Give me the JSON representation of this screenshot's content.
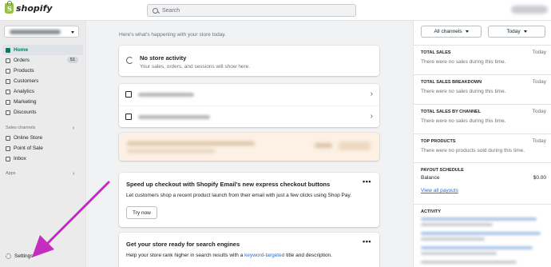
{
  "topbar": {
    "logo_text": "shopify",
    "search_placeholder": "Search"
  },
  "sidebar": {
    "items": [
      {
        "label": "Home",
        "icon": "home-icon",
        "active": true
      },
      {
        "label": "Orders",
        "icon": "orders-icon",
        "badge": "51"
      },
      {
        "label": "Products",
        "icon": "tag-icon"
      },
      {
        "label": "Customers",
        "icon": "person-icon"
      },
      {
        "label": "Analytics",
        "icon": "bar-chart-icon"
      },
      {
        "label": "Marketing",
        "icon": "target-icon"
      },
      {
        "label": "Discounts",
        "icon": "discount-icon"
      }
    ],
    "sales_channels_label": "Sales channels",
    "channels": [
      {
        "label": "Online Store",
        "icon": "store-icon"
      },
      {
        "label": "Point of Sale",
        "icon": "pos-icon"
      },
      {
        "label": "Inbox",
        "icon": "inbox-icon"
      }
    ],
    "apps_label": "Apps",
    "settings_label": "Settings"
  },
  "main": {
    "intro": "Here's what's happening with your store today.",
    "activity_card": {
      "title": "No store activity",
      "subtitle": "Your sales, orders, and sessions will show here."
    },
    "promo_email": {
      "title": "Speed up checkout with Shopify Email's new express checkout buttons",
      "body": "Let customers shop a recent product launch from their email with just a few clicks using Shop Pay.",
      "button": "Try now",
      "menu": "•••"
    },
    "promo_seo": {
      "title": "Get your store ready for search engines",
      "body_before": "Help your store rank higher in search results with a ",
      "link": "keyword-targeted",
      "body_after": " title and description.",
      "menu": "•••"
    }
  },
  "right_panel": {
    "channel_filter": "All channels",
    "date_filter": "Today",
    "metrics": [
      {
        "title": "TOTAL SALES",
        "period": "Today",
        "text": "There were no sales during this time."
      },
      {
        "title": "TOTAL SALES BREAKDOWN",
        "period": "Today",
        "text": "There were no sales during this time."
      },
      {
        "title": "TOTAL SALES BY CHANNEL",
        "period": "Today",
        "text": "There were no sales during this time."
      },
      {
        "title": "TOP PRODUCTS",
        "period": "Today",
        "text": "There were no products sold during this time."
      }
    ],
    "payout": {
      "title": "PAYOUT SCHEDULE",
      "balance_label": "Balance",
      "balance_value": "$0.00",
      "link": "View all payouts"
    },
    "activity_title": "ACTIVITY"
  },
  "colors": {
    "accent_green": "#008060",
    "link_blue": "#2c6ecb",
    "annotation_arrow": "#c72cc1"
  }
}
